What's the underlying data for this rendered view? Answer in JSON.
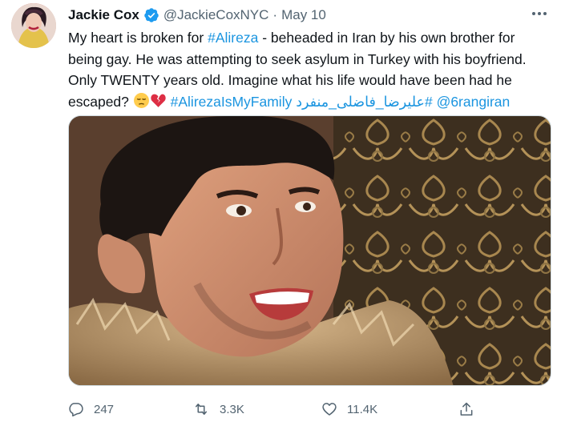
{
  "tweet": {
    "author": {
      "name": "Jackie Cox",
      "handle": "@JackieCoxNYC",
      "verified": true,
      "avatar_icon": "avatar-portrait"
    },
    "separator": "·",
    "date": "May 10",
    "text_parts": {
      "p1": "My heart is broken for ",
      "hashtag1": "#Alireza",
      "p2": " - beheaded in Iran by his own brother for being gay. He was attempting to seek asylum in Turkey with his boyfriend. Only TWENTY years old. Imagine what his life would have been had he escaped? ",
      "emoji1": "pensive-face",
      "emoji2": "broken-heart",
      "hashtag2": "#AlirezaIsMyFamily",
      "hashtag3": "#علیرضا_فاضلی_منفرد",
      "mention": "@6rangiran"
    },
    "media": {
      "type": "photo",
      "description_icon": "photo"
    },
    "actions": {
      "reply_count": "247",
      "retweet_count": "3.3K",
      "like_count": "11.4K"
    },
    "colors": {
      "link": "#1b95e0",
      "verified": "#1d9bf0",
      "secondary_text": "#536471"
    }
  }
}
